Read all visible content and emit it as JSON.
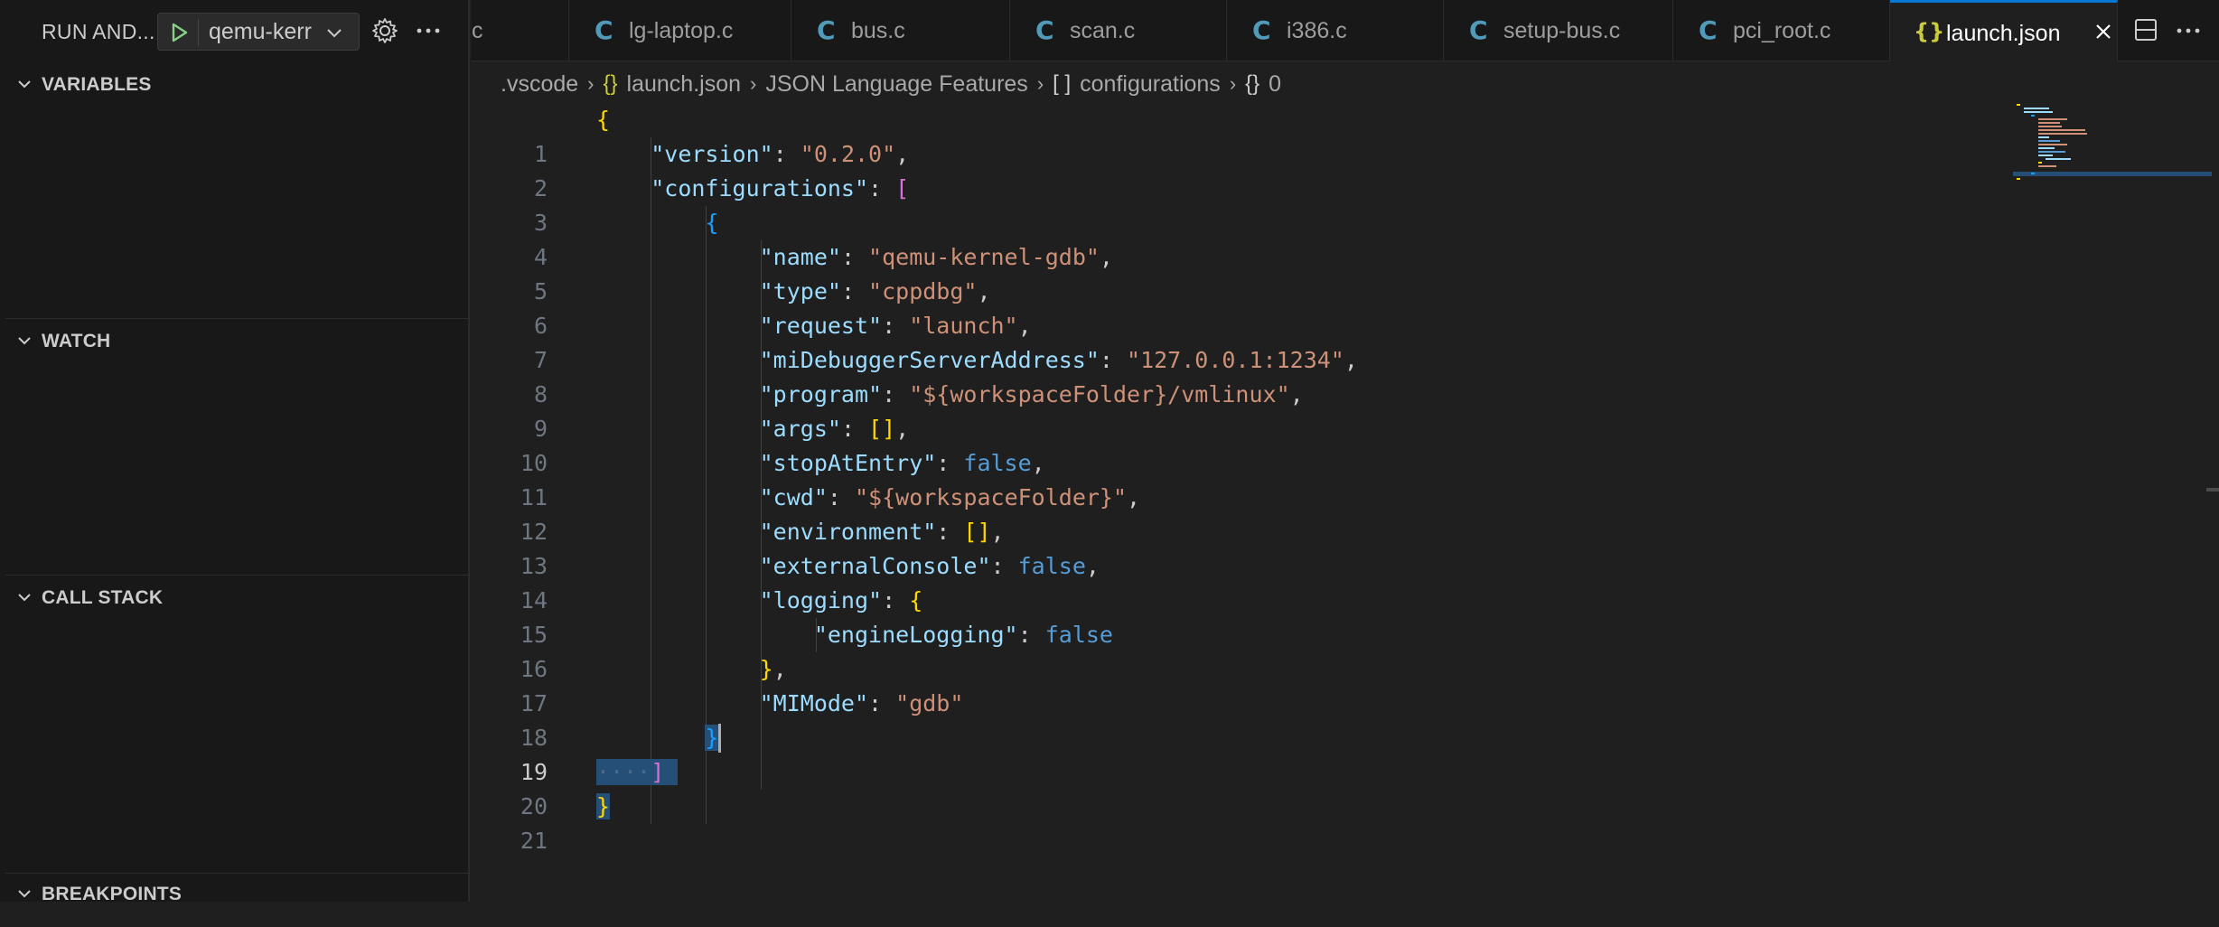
{
  "sidebar": {
    "title": "RUN AND...",
    "launch_config": "qemu-kerr",
    "sections": [
      {
        "label": "VARIABLES"
      },
      {
        "label": "WATCH"
      },
      {
        "label": "CALL STACK"
      },
      {
        "label": "BREAKPOINTS"
      }
    ]
  },
  "tabs": [
    {
      "icon": "C",
      "label": "c"
    },
    {
      "icon": "C",
      "label": "lg-laptop.c"
    },
    {
      "icon": "C",
      "label": "bus.c"
    },
    {
      "icon": "C",
      "label": "scan.c"
    },
    {
      "icon": "C",
      "label": "i386.c"
    },
    {
      "icon": "C",
      "label": "setup-bus.c"
    },
    {
      "icon": "C",
      "label": "pci_root.c"
    },
    {
      "icon": "{}",
      "label": "launch.json"
    }
  ],
  "breadcrumb": {
    "folder": ".vscode",
    "file_icon": "{}",
    "file": "launch.json",
    "symbol1": "JSON Language Features",
    "symbol2_icon": "[ ]",
    "symbol2": "configurations",
    "symbol3_icon": "{}",
    "symbol3": "0"
  },
  "editor": {
    "current_line": 19,
    "line_numbers": [
      "1",
      "2",
      "3",
      "4",
      "5",
      "6",
      "7",
      "8",
      "9",
      "10",
      "11",
      "12",
      "13",
      "14",
      "15",
      "16",
      "17",
      "18",
      "19",
      "20",
      "21"
    ],
    "tokens": {
      "l1_open": "{",
      "l2_key": "\"version\"",
      "l2_val": "\"0.2.0\"",
      "l3_key": "\"configurations\"",
      "l3_open": "[",
      "l4_open": "{",
      "l5_key": "\"name\"",
      "l5_val": "\"qemu-kernel-gdb\"",
      "l6_key": "\"type\"",
      "l6_val": "\"cppdbg\"",
      "l7_key": "\"request\"",
      "l7_val": "\"launch\"",
      "l8_key": "\"miDebuggerServerAddress\"",
      "l8_val": "\"127.0.0.1:1234\"",
      "l9_key": "\"program\"",
      "l9_val": "\"${workspaceFolder}/vmlinux\"",
      "l10_key": "\"args\"",
      "l10_val": "[]",
      "l11_key": "\"stopAtEntry\"",
      "l11_val": "false",
      "l12_key": "\"cwd\"",
      "l12_val": "\"${workspaceFolder}\"",
      "l13_key": "\"environment\"",
      "l13_val": "[]",
      "l14_key": "\"externalConsole\"",
      "l14_val": "false",
      "l15_key": "\"logging\"",
      "l15_open": "{",
      "l16_key": "\"engineLogging\"",
      "l16_val": "false",
      "l17_close": "}",
      "l18_key": "\"MIMode\"",
      "l18_val": "\"gdb\"",
      "l19_close": "}",
      "l20_ws": "····",
      "l20_close": "]",
      "l21_close": "}"
    }
  },
  "icons": {
    "play": "play-icon",
    "gear": "gear-icon",
    "more": "ellipsis-icon",
    "close": "close-icon",
    "split": "split-editor-icon",
    "chevron": "chevron-down-icon"
  },
  "colors": {
    "accent": "#0078d4",
    "run_green": "#89d185",
    "json_icon": "#cbcb41",
    "c_icon": "#519aba"
  }
}
